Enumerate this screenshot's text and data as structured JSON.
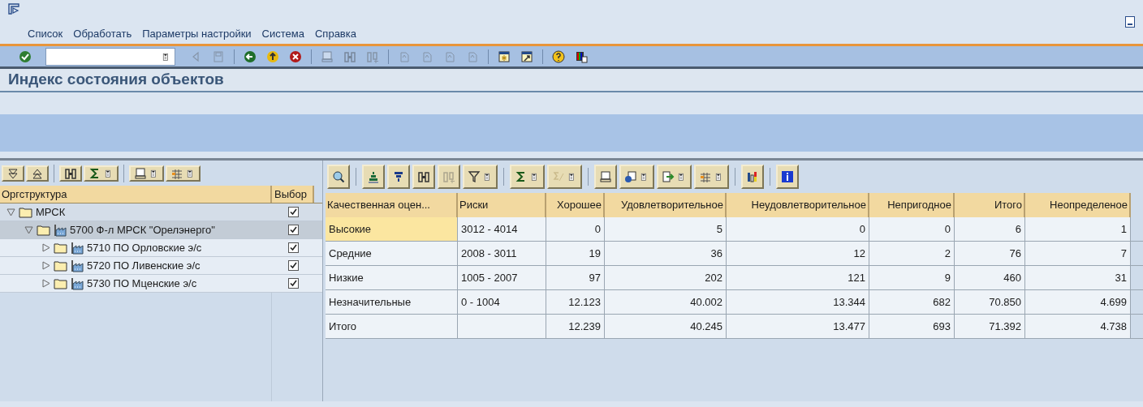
{
  "menu": [
    {
      "label": "Список"
    },
    {
      "label": "Обработать"
    },
    {
      "label": "Параметры настройки"
    },
    {
      "label": "Система"
    },
    {
      "label": "Справка"
    }
  ],
  "toolbar": [
    {
      "kind": "enter",
      "disabled": false
    },
    {
      "kind": "field"
    },
    {
      "kind": "back-arrow",
      "disabled": true
    },
    {
      "kind": "save",
      "disabled": true
    },
    {
      "kind": "sep"
    },
    {
      "kind": "back",
      "disabled": false
    },
    {
      "kind": "exit",
      "disabled": false
    },
    {
      "kind": "cancel",
      "disabled": false
    },
    {
      "kind": "sep"
    },
    {
      "kind": "print",
      "disabled": true
    },
    {
      "kind": "find",
      "disabled": true
    },
    {
      "kind": "find-next",
      "disabled": true
    },
    {
      "kind": "sep"
    },
    {
      "kind": "page",
      "disabled": true
    },
    {
      "kind": "page",
      "disabled": true
    },
    {
      "kind": "page",
      "disabled": true
    },
    {
      "kind": "page",
      "disabled": true
    },
    {
      "kind": "sep"
    },
    {
      "kind": "new-session",
      "disabled": false
    },
    {
      "kind": "shortcut",
      "disabled": false
    },
    {
      "kind": "sep"
    },
    {
      "kind": "help",
      "disabled": false
    },
    {
      "kind": "layout-menu",
      "disabled": false
    }
  ],
  "title": "Индекс состояния объектов",
  "tree_toolbar": [
    {
      "kind": "expand",
      "disabled": false
    },
    {
      "kind": "collapse",
      "disabled": false
    },
    {
      "kind": "sep"
    },
    {
      "kind": "find",
      "disabled": false
    },
    {
      "kind": "sum",
      "disabled": false,
      "dropdown": true
    },
    {
      "kind": "sep"
    },
    {
      "kind": "print",
      "disabled": false,
      "dropdown": true
    },
    {
      "kind": "layout",
      "disabled": false,
      "dropdown": true
    }
  ],
  "tree": {
    "columns": [
      "Оргструктура",
      "Выбор"
    ],
    "nodes": [
      {
        "label": "МРСК",
        "plant": false,
        "expanded": true,
        "checked": true,
        "selected": false,
        "children": [
          {
            "label": "5700 Ф-л МРСК \"Орелэнерго\"",
            "plant": true,
            "expanded": true,
            "checked": true,
            "selected": true,
            "children": [
              {
                "label": "5710 ПО Орловские э/с",
                "plant": true,
                "expanded": false,
                "checked": true,
                "selected": false
              },
              {
                "label": "5720 ПО Ливенские э/с",
                "plant": true,
                "expanded": false,
                "checked": true,
                "selected": false
              },
              {
                "label": "5730 ПО Мценские э/с",
                "plant": true,
                "expanded": false,
                "checked": true,
                "selected": false
              }
            ]
          }
        ]
      }
    ]
  },
  "grid_toolbar": [
    {
      "kind": "details",
      "disabled": false
    },
    {
      "kind": "sep"
    },
    {
      "kind": "sort-asc",
      "disabled": false
    },
    {
      "kind": "sort-desc",
      "disabled": false
    },
    {
      "kind": "find",
      "disabled": false
    },
    {
      "kind": "find-next",
      "disabled": true
    },
    {
      "kind": "filter",
      "disabled": false,
      "dropdown": true
    },
    {
      "kind": "sep"
    },
    {
      "kind": "sum",
      "disabled": false,
      "dropdown": true
    },
    {
      "kind": "subtotal",
      "disabled": true,
      "dropdown": true
    },
    {
      "kind": "sep"
    },
    {
      "kind": "print",
      "disabled": false
    },
    {
      "kind": "views",
      "disabled": false,
      "dropdown": true
    },
    {
      "kind": "export",
      "disabled": false,
      "dropdown": true
    },
    {
      "kind": "layout",
      "disabled": false,
      "dropdown": true
    },
    {
      "kind": "sep"
    },
    {
      "kind": "graphic",
      "disabled": false
    },
    {
      "kind": "sep"
    },
    {
      "kind": "info",
      "disabled": false
    }
  ],
  "table": {
    "columns": [
      {
        "label": "Качественная оцен..."
      },
      {
        "label": "Риски"
      },
      {
        "label": "Хорошее"
      },
      {
        "label": "Удовлетворительное"
      },
      {
        "label": "Неудовлетворительное"
      },
      {
        "label": "Непригодное"
      },
      {
        "label": "Итого"
      },
      {
        "label": "Неопределеное"
      }
    ],
    "rows": [
      {
        "selected": true,
        "cells": [
          "Высокие",
          "3012 - 4014",
          "0",
          "5",
          "0",
          "0",
          "6",
          "1"
        ]
      },
      {
        "selected": false,
        "cells": [
          "Средние",
          "2008 - 3011",
          "19",
          "36",
          "12",
          "2",
          "76",
          "7"
        ]
      },
      {
        "selected": false,
        "cells": [
          "Низкие",
          "1005 - 2007",
          "97",
          "202",
          "121",
          "9",
          "460",
          "31"
        ]
      },
      {
        "selected": false,
        "cells": [
          "Незначительные",
          "0 - 1004",
          "12.123",
          "40.002",
          "13.344",
          "682",
          "70.850",
          "4.699"
        ]
      },
      {
        "selected": false,
        "cells": [
          "Итого",
          "",
          "12.239",
          "40.245",
          "13.477",
          "693",
          "71.392",
          "4.738"
        ]
      }
    ]
  }
}
